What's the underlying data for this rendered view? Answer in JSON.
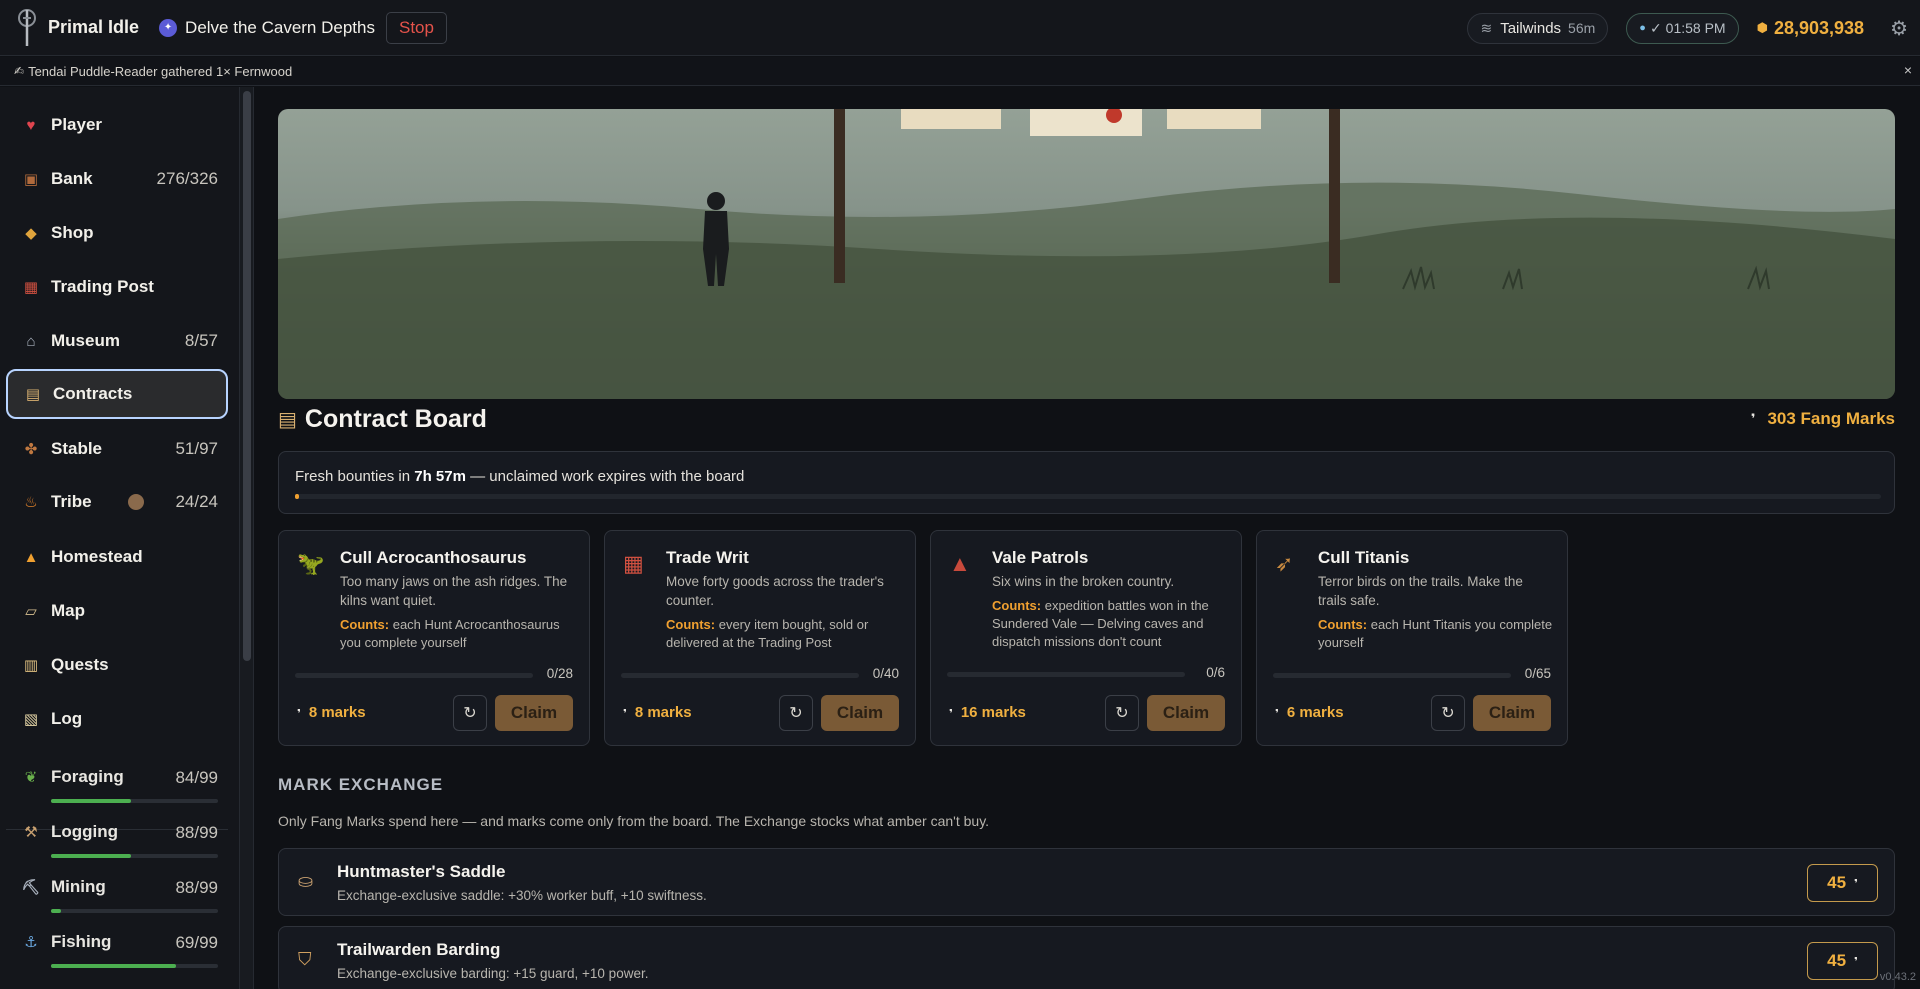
{
  "app": {
    "title": "Primal Idle"
  },
  "activity": {
    "name": "Delve the Cavern Depths",
    "stop_label": "Stop"
  },
  "status": {
    "weather": "Tailwinds",
    "weather_time": "56m",
    "clock": "01:58 PM",
    "amber": "28,903,938"
  },
  "notification": {
    "text": "Tendai Puddle-Reader gathered 1× Fernwood",
    "close": "×"
  },
  "sidebar": {
    "items": [
      {
        "label": "Player",
        "count": "",
        "icon": "heart-icon"
      },
      {
        "label": "Bank",
        "count": "276/326",
        "icon": "chest-icon"
      },
      {
        "label": "Shop",
        "count": "",
        "icon": "box-icon"
      },
      {
        "label": "Trading Post",
        "count": "",
        "icon": "stall-icon"
      },
      {
        "label": "Museum",
        "count": "8/57",
        "icon": "museum-icon"
      },
      {
        "label": "Contracts",
        "count": "",
        "icon": "contract-icon"
      },
      {
        "label": "Stable",
        "count": "51/97",
        "icon": "paw-icon"
      },
      {
        "label": "Tribe",
        "count": "24/24",
        "icon": "fire-icon"
      },
      {
        "label": "Homestead",
        "count": "",
        "icon": "tent-icon"
      },
      {
        "label": "Map",
        "count": "",
        "icon": "map-icon"
      },
      {
        "label": "Quests",
        "count": "",
        "icon": "clipboard-icon"
      },
      {
        "label": "Log",
        "count": "",
        "icon": "scroll-icon"
      }
    ],
    "skills": [
      {
        "label": "Foraging",
        "count": "84/99",
        "progress": 0.48
      },
      {
        "label": "Logging",
        "count": "88/99",
        "progress": 0.48
      },
      {
        "label": "Mining",
        "count": "88/99",
        "progress": 0.06
      },
      {
        "label": "Fishing",
        "count": "69/99",
        "progress": 0.75
      }
    ]
  },
  "board": {
    "title": "Contract Board",
    "marks_total": "303 Fang Marks",
    "refresh_prefix": "Fresh bounties in ",
    "refresh_time": "7h 57m",
    "refresh_suffix": " — unclaimed work expires with the board",
    "refresh_progress": 0.003,
    "contracts": [
      {
        "title": "Cull Acrocanthosaurus",
        "desc": "Too many jaws on the ash ridges. The kilns want quiet.",
        "counts_label": "Counts:",
        "counts_text": " each Hunt Acrocanthosaurus you complete yourself",
        "progress": "0/28",
        "reward": "8 marks",
        "claim": "Claim",
        "icon": "raptor-icon"
      },
      {
        "title": "Trade Writ",
        "desc": "Move forty goods across the trader's counter.",
        "counts_label": "Counts:",
        "counts_text": " every item bought, sold or delivered at the Trading Post",
        "progress": "0/40",
        "reward": "8 marks",
        "claim": "Claim",
        "icon": "stall-icon"
      },
      {
        "title": "Vale Patrols",
        "desc": "Six wins in the broken country.",
        "counts_label": "Counts:",
        "counts_text": " expedition battles won in the Sundered Vale — Delving caves and dispatch missions don't count",
        "progress": "0/6",
        "reward": "16 marks",
        "claim": "Claim",
        "icon": "volcano-icon"
      },
      {
        "title": "Cull Titanis",
        "desc": "Terror birds on the trails. Make the trails safe.",
        "counts_label": "Counts:",
        "counts_text": " each Hunt Titanis you complete yourself",
        "progress": "0/65",
        "reward": "6 marks",
        "claim": "Claim",
        "icon": "bird-icon"
      }
    ]
  },
  "exchange": {
    "title": "MARK EXCHANGE",
    "subtitle": "Only Fang Marks spend here — and marks come only from the board. The Exchange stocks what amber can't buy.",
    "items": [
      {
        "name": "Huntmaster's Saddle",
        "desc": "Exchange-exclusive saddle: +30% worker buff, +10 swiftness.",
        "price": "45",
        "icon": "saddle-icon"
      },
      {
        "name": "Trailwarden Barding",
        "desc": "Exchange-exclusive barding: +15 guard, +10 power.",
        "price": "45",
        "icon": "barding-icon"
      }
    ]
  },
  "version": "v0.43.2"
}
